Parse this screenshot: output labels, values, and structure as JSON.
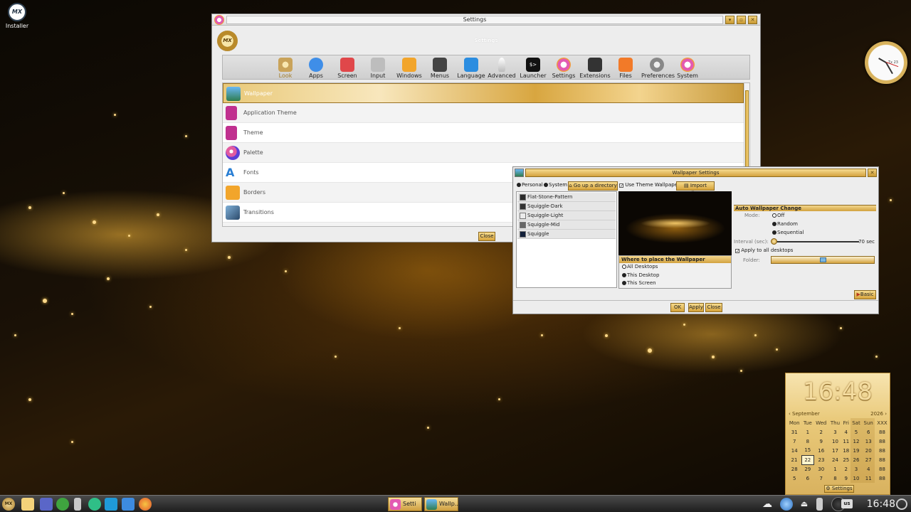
{
  "desktop": {
    "installer_label": "Installer",
    "installer_logo": "MX"
  },
  "settings": {
    "title": "Settings",
    "subtitle": "Settings",
    "badge_text": "MX",
    "toolbar": [
      {
        "label": "Look",
        "icon": "palette-icon",
        "color": "#c9a35a"
      },
      {
        "label": "Apps",
        "icon": "apps-icon",
        "color": "#3f8ee8"
      },
      {
        "label": "Screen",
        "icon": "screen-icon",
        "color": "#e0474a"
      },
      {
        "label": "Input",
        "icon": "input-icon",
        "color": "#aaaaaa"
      },
      {
        "label": "Windows",
        "icon": "windows-icon",
        "color": "#f2a52b"
      },
      {
        "label": "Menus",
        "icon": "menus-icon",
        "color": "#444444"
      },
      {
        "label": "Language",
        "icon": "language-icon",
        "color": "#2b8de0"
      },
      {
        "label": "Advanced",
        "icon": "rocket-icon",
        "color": "#dddddd"
      },
      {
        "label": "Launcher",
        "icon": "terminal-icon",
        "color": "#111111"
      },
      {
        "label": "Settings",
        "icon": "gear-icon",
        "color": "#e35ab2"
      },
      {
        "label": "Extensions",
        "icon": "extensions-icon",
        "color": "#333333"
      },
      {
        "label": "Files",
        "icon": "folder-icon",
        "color": "#f27a28"
      },
      {
        "label": "Preferences",
        "icon": "preferences-icon",
        "color": "#888888"
      },
      {
        "label": "System",
        "icon": "system-gear-icon",
        "color": "#e35ab2"
      }
    ],
    "items": [
      {
        "label": "Wallpaper",
        "icon": "wallpaper-icon",
        "color": "#3f8ee8"
      },
      {
        "label": "Application Theme",
        "icon": "theme-brush-icon",
        "color": "#c0308f"
      },
      {
        "label": "Theme",
        "icon": "theme-icon",
        "color": "#c0308f"
      },
      {
        "label": "Palette",
        "icon": "palette-icon",
        "color": "#e25aa0"
      },
      {
        "label": "Fonts",
        "icon": "fonts-icon",
        "color": "#2a7fd4"
      },
      {
        "label": "Borders",
        "icon": "borders-icon",
        "color": "#f2a52b"
      },
      {
        "label": "Transitions",
        "icon": "transitions-icon",
        "color": "#3c6e9a"
      }
    ],
    "close_label": "Close"
  },
  "wallpaper_dialog": {
    "title": "Wallpaper Settings",
    "source_personal": "Personal",
    "source_system": "System",
    "go_up": "Go up a directory",
    "use_theme": "Use Theme Wallpaper",
    "import_file": "Import File...",
    "files": [
      {
        "name": "Flat-Stone-Pattern",
        "color": "#2a2a2a"
      },
      {
        "name": "Squiggle-Dark",
        "color": "#333333"
      },
      {
        "name": "Squiggle-Light",
        "color": "#ececec"
      },
      {
        "name": "Squiggle-Mid",
        "color": "#666666"
      },
      {
        "name": "Squiggle",
        "color": "#13203a"
      }
    ],
    "place_title": "Where to place the Wallpaper",
    "place_options": [
      "All Desktops",
      "This Desktop",
      "This Screen"
    ],
    "auto_title": "Auto Wallpaper Change",
    "mode_label": "Mode:",
    "modes": [
      "Off",
      "Random",
      "Sequential"
    ],
    "interval_label": "Interval (sec):",
    "interval_value": "70 sec",
    "apply_all": "Apply to all desktops",
    "folder_label": "Folder:",
    "basic_label": "Basic",
    "ok_label": "OK",
    "apply_label": "Apply",
    "close_label": "Close"
  },
  "clock_widget": {
    "brand": "Tx 23"
  },
  "calendar": {
    "time": "16:48",
    "month": "September",
    "year": "2026",
    "dow": [
      "Mon",
      "Tue",
      "Wed",
      "Thu",
      "Fri",
      "Sat",
      "Sun",
      "XXX"
    ],
    "weeks": [
      [
        "31",
        "1",
        "2",
        "3",
        "4",
        "5",
        "6",
        "88"
      ],
      [
        "7",
        "8",
        "9",
        "10",
        "11",
        "12",
        "13",
        "88"
      ],
      [
        "14",
        "15",
        "16",
        "17",
        "18",
        "19",
        "20",
        "88"
      ],
      [
        "21",
        "22",
        "23",
        "24",
        "25",
        "26",
        "27",
        "88"
      ],
      [
        "28",
        "29",
        "30",
        "1",
        "2",
        "3",
        "4",
        "88"
      ],
      [
        "5",
        "6",
        "7",
        "8",
        "9",
        "10",
        "11",
        "88"
      ]
    ],
    "today": "22",
    "settings_label": "Settings"
  },
  "panel": {
    "start_label": "MX",
    "tasks": [
      "Setti",
      "Wallp..."
    ],
    "kbd": "us",
    "time": "16:48"
  }
}
